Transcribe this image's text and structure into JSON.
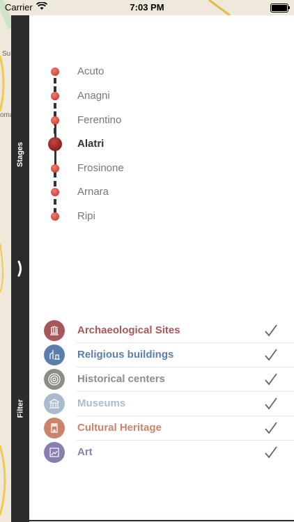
{
  "status_bar": {
    "carrier": "Carrier",
    "time": "7:03 PM"
  },
  "map": {
    "label_fragments": [
      "Su",
      "oma"
    ]
  },
  "sidebar": {
    "stages_tab": "Stages",
    "filter_tab": "Filter"
  },
  "stages": {
    "items": [
      {
        "label": "Acuto",
        "active": false
      },
      {
        "label": "Anagni",
        "active": false
      },
      {
        "label": "Ferentino",
        "active": false
      },
      {
        "label": "Alatri",
        "active": true
      },
      {
        "label": "Frosinone",
        "active": false
      },
      {
        "label": "Arnara",
        "active": false
      },
      {
        "label": "Ripi",
        "active": false
      }
    ]
  },
  "filters": {
    "items": [
      {
        "label": "Archaeological Sites",
        "color": "#a7575a",
        "icon": "columns-icon",
        "checked": true
      },
      {
        "label": "Religious buildings",
        "color": "#5b7eab",
        "icon": "church-icon",
        "checked": true
      },
      {
        "label": "Historical centers",
        "color": "#8e8c85",
        "icon": "target-icon",
        "checked": true
      },
      {
        "label": "Museums",
        "color": "#a9bccd",
        "icon": "museum-icon",
        "checked": true
      },
      {
        "label": "Cultural Heritage",
        "color": "#c9846b",
        "icon": "tower-icon",
        "checked": true
      },
      {
        "label": "Art",
        "color": "#8a7db0",
        "icon": "frame-icon",
        "checked": true
      }
    ]
  }
}
